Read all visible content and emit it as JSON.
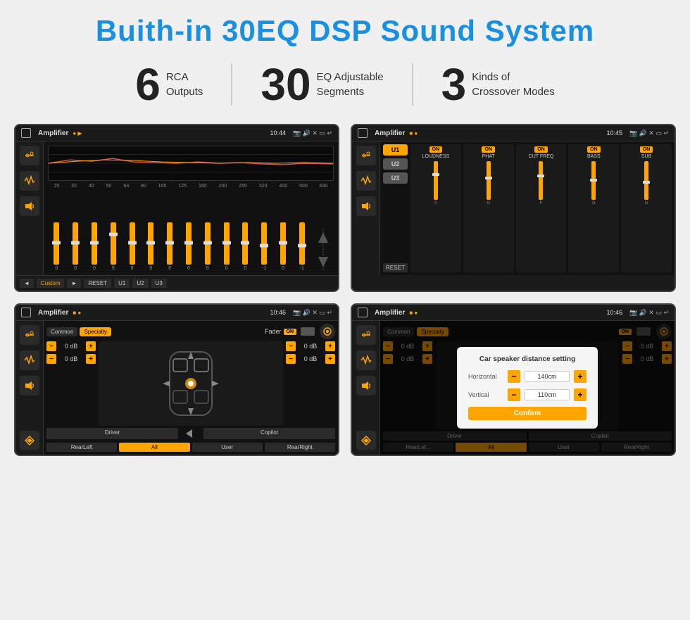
{
  "header": {
    "title": "Buith-in 30EQ DSP Sound System"
  },
  "stats": [
    {
      "number": "6",
      "label_line1": "RCA",
      "label_line2": "Outputs"
    },
    {
      "number": "30",
      "label_line1": "EQ Adjustable",
      "label_line2": "Segments"
    },
    {
      "number": "3",
      "label_line1": "Kinds of",
      "label_line2": "Crossover Modes"
    }
  ],
  "screens": {
    "eq": {
      "app_name": "Amplifier",
      "time": "10:44",
      "freqs": [
        "25",
        "32",
        "40",
        "50",
        "63",
        "80",
        "100",
        "125",
        "160",
        "200",
        "250",
        "320",
        "400",
        "500",
        "630"
      ],
      "vals": [
        "0",
        "0",
        "0",
        "5",
        "0",
        "0",
        "0",
        "0",
        "0",
        "0",
        "0",
        "-1",
        "0",
        "-1"
      ],
      "bottom_btns": [
        "◄",
        "Custom",
        "►",
        "RESET",
        "U1",
        "U2",
        "U3"
      ]
    },
    "crossover": {
      "app_name": "Amplifier",
      "time": "10:45",
      "u_btns": [
        "U1",
        "U2",
        "U3"
      ],
      "channels": [
        "LOUDNESS",
        "PHAT",
        "CUT FREQ",
        "BASS",
        "SUB"
      ],
      "reset": "RESET"
    },
    "fader": {
      "app_name": "Amplifier",
      "time": "10:46",
      "tabs": [
        "Common",
        "Specialty"
      ],
      "fader_label": "Fader",
      "on_label": "ON",
      "left_dbs": [
        "0 dB",
        "0 dB"
      ],
      "right_dbs": [
        "0 dB",
        "0 dB"
      ],
      "bottom_btns": [
        "Driver",
        "",
        "Copilot",
        "RearLeft",
        "All",
        "User",
        "RearRight"
      ]
    },
    "distance": {
      "app_name": "Amplifier",
      "time": "10:46",
      "tabs": [
        "Common",
        "Specialty"
      ],
      "dialog_title": "Car speaker distance setting",
      "horizontal_label": "Horizontal",
      "horizontal_val": "140cm",
      "vertical_label": "Vertical",
      "vertical_val": "110cm",
      "confirm_label": "Confirm",
      "right_dbs": [
        "0 dB",
        "0 dB"
      ],
      "bottom_btns": [
        "Driver",
        "Copilot",
        "RearLeft",
        "All",
        "User",
        "RearRight"
      ]
    }
  }
}
